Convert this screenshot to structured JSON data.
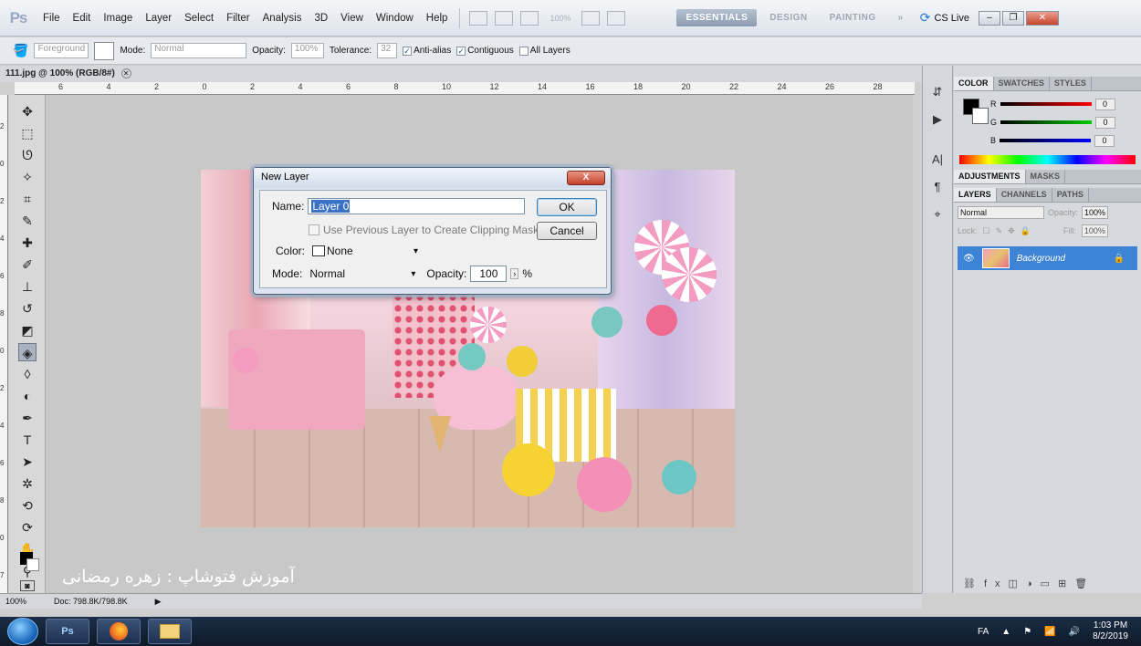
{
  "app": {
    "logo": "Ps"
  },
  "menu": [
    "File",
    "Edit",
    "Image",
    "Layer",
    "Select",
    "Filter",
    "Analysis",
    "3D",
    "View",
    "Window",
    "Help"
  ],
  "zoom_display": "100%",
  "workspaces": [
    "ESSENTIALS",
    "DESIGN",
    "PAINTING",
    "»"
  ],
  "cslive": "CS Live",
  "options": {
    "fill_source": "Foreground",
    "mode_label": "Mode:",
    "mode_value": "Normal",
    "opacity_label": "Opacity:",
    "opacity_value": "100%",
    "tolerance_label": "Tolerance:",
    "tolerance_value": "32",
    "antialias_label": "Anti-alias",
    "contiguous_label": "Contiguous",
    "all_layers_label": "All Layers"
  },
  "document": {
    "tab_title": "111.jpg @ 100% (RGB/8#)"
  },
  "ruler_top": [
    "6",
    "4",
    "2",
    "0",
    "2",
    "4",
    "6",
    "8",
    "10",
    "12",
    "14",
    "16",
    "18",
    "20",
    "22",
    "24",
    "26",
    "28"
  ],
  "ruler_left": [
    "2",
    "0",
    "2",
    "4",
    "6",
    "8",
    "0",
    "2",
    "4",
    "6",
    "8",
    "0",
    "7"
  ],
  "dialog": {
    "title": "New Layer",
    "close": "X",
    "name_label": "Name:",
    "name_value": "Layer 0",
    "clipping_label": "Use Previous Layer to Create Clipping Mask",
    "color_label": "Color:",
    "color_value": "None",
    "mode_label": "Mode:",
    "mode_value": "Normal",
    "opacity_label": "Opacity:",
    "opacity_value": "100",
    "opacity_unit": "%",
    "ok": "OK",
    "cancel": "Cancel"
  },
  "watermark": "آموزش فتوشاپ : زهره رمضانی",
  "panels": {
    "color_tabs": [
      "COLOR",
      "SWATCHES",
      "STYLES"
    ],
    "sliders": [
      {
        "label": "R",
        "value": "0"
      },
      {
        "label": "G",
        "value": "0"
      },
      {
        "label": "B",
        "value": "0"
      }
    ],
    "adjust_tabs": [
      "ADJUSTMENTS",
      "MASKS"
    ],
    "layer_tabs": [
      "LAYERS",
      "CHANNELS",
      "PATHS"
    ],
    "blend_mode": "Normal",
    "opacity_label": "Opacity:",
    "opacity_value": "100%",
    "lock_label": "Lock:",
    "fill_label": "Fill:",
    "fill_value": "100%",
    "layer_name": "Background"
  },
  "status": {
    "zoom": "100%",
    "doc": "Doc: 798.8K/798.8K"
  },
  "taskbar": {
    "lang": "FA",
    "time": "1:03 PM",
    "date": "8/2/2019"
  }
}
